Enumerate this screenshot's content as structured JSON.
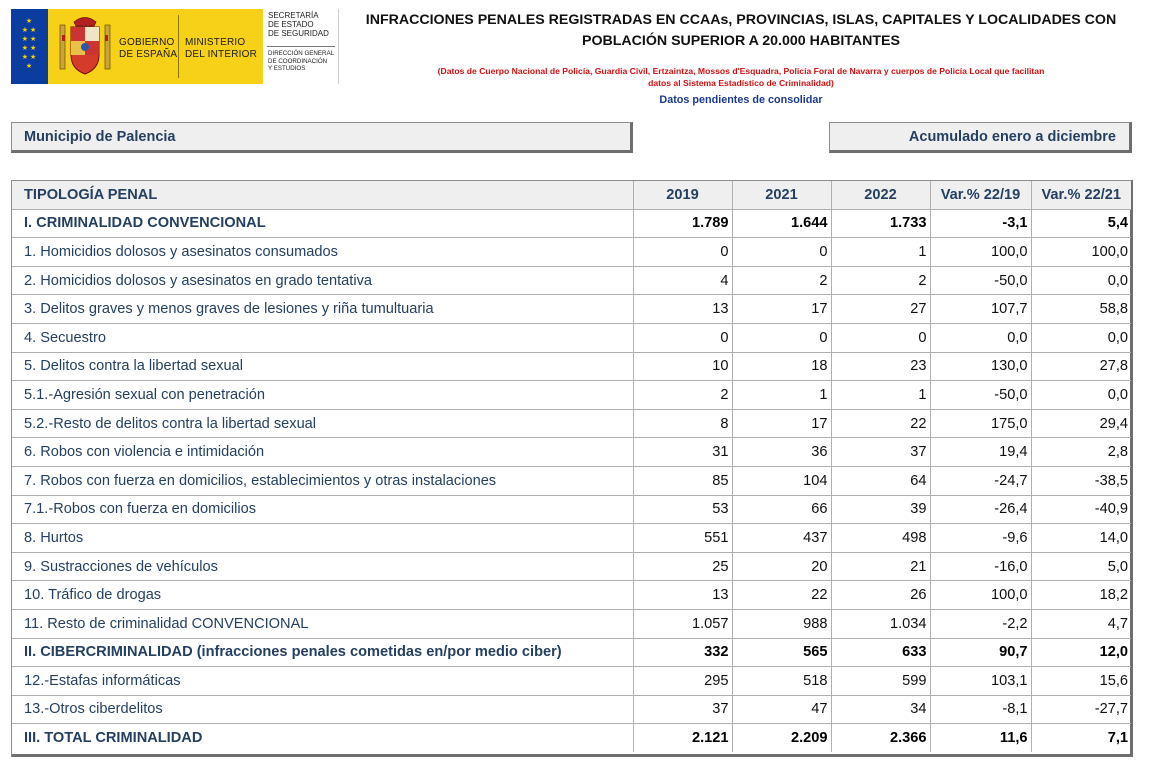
{
  "logo": {
    "gobierno": [
      "GOBIERNO",
      "DE ESPAÑA"
    ],
    "ministerio": [
      "MINISTERIO",
      "DEL INTERIOR"
    ],
    "secretaria": [
      "SECRETARÍA",
      "DE ESTADO",
      "DE SEGURIDAD"
    ],
    "direccion": [
      "DIRECCIÓN GENERAL",
      "DE COORDINACIÓN",
      "Y ESTUDIOS"
    ]
  },
  "header": {
    "title_line1": "INFRACCIONES PENALES REGISTRADAS EN CCAAs, PROVINCIAS, ISLAS, CAPITALES Y LOCALIDADES CON",
    "title_line2": "POBLACIÓN SUPERIOR A 20.000 HABITANTES",
    "source_line1": "(Datos de Cuerpo Nacional de Policía, Guardia Civil, Ertzaintza, Mossos d'Esquadra, Policía Foral de Navarra y cuerpos de Policía Local que facilitan",
    "source_line2": "datos al Sistema Estadístico de Criminalidad)",
    "pending": "Datos pendientes de consolidar"
  },
  "info": {
    "municipio": "Municipio de Palencia",
    "periodo": "Acumulado enero a diciembre"
  },
  "table": {
    "headers": [
      "TIPOLOGÍA PENAL",
      "2019",
      "2021",
      "2022",
      "Var.% 22/19",
      "Var.% 22/21"
    ],
    "rows": [
      {
        "label": "I. CRIMINALIDAD CONVENCIONAL",
        "v2019": "1.789",
        "v2021": "1.644",
        "v2022": "1.733",
        "var1": "-3,1",
        "var2": "5,4",
        "bold": true
      },
      {
        "label": "1. Homicidios dolosos y asesinatos consumados",
        "v2019": "0",
        "v2021": "0",
        "v2022": "1",
        "var1": "100,0",
        "var2": "100,0"
      },
      {
        "label": "2. Homicidios dolosos y asesinatos en grado tentativa",
        "v2019": "4",
        "v2021": "2",
        "v2022": "2",
        "var1": "-50,0",
        "var2": "0,0"
      },
      {
        "label": "3. Delitos graves y menos graves de lesiones y riña tumultuaria",
        "v2019": "13",
        "v2021": "17",
        "v2022": "27",
        "var1": "107,7",
        "var2": "58,8"
      },
      {
        "label": "4. Secuestro",
        "v2019": "0",
        "v2021": "0",
        "v2022": "0",
        "var1": "0,0",
        "var2": "0,0"
      },
      {
        "label": "5. Delitos contra la libertad sexual",
        "v2019": "10",
        "v2021": "18",
        "v2022": "23",
        "var1": "130,0",
        "var2": "27,8"
      },
      {
        "label": "5.1.-Agresión sexual con penetración",
        "v2019": "2",
        "v2021": "1",
        "v2022": "1",
        "var1": "-50,0",
        "var2": "0,0"
      },
      {
        "label": "5.2.-Resto de delitos contra la libertad sexual",
        "v2019": "8",
        "v2021": "17",
        "v2022": "22",
        "var1": "175,0",
        "var2": "29,4"
      },
      {
        "label": "6. Robos con violencia e intimidación",
        "v2019": "31",
        "v2021": "36",
        "v2022": "37",
        "var1": "19,4",
        "var2": "2,8"
      },
      {
        "label": "7. Robos con fuerza en domicilios, establecimientos y otras instalaciones",
        "v2019": "85",
        "v2021": "104",
        "v2022": "64",
        "var1": "-24,7",
        "var2": "-38,5"
      },
      {
        "label": "7.1.-Robos con fuerza en domicilios",
        "v2019": "53",
        "v2021": "66",
        "v2022": "39",
        "var1": "-26,4",
        "var2": "-40,9"
      },
      {
        "label": "8. Hurtos",
        "v2019": "551",
        "v2021": "437",
        "v2022": "498",
        "var1": "-9,6",
        "var2": "14,0"
      },
      {
        "label": "9. Sustracciones de vehículos",
        "v2019": "25",
        "v2021": "20",
        "v2022": "21",
        "var1": "-16,0",
        "var2": "5,0"
      },
      {
        "label": "10. Tráfico de drogas",
        "v2019": "13",
        "v2021": "22",
        "v2022": "26",
        "var1": "100,0",
        "var2": "18,2"
      },
      {
        "label": "11. Resto de criminalidad CONVENCIONAL",
        "v2019": "1.057",
        "v2021": "988",
        "v2022": "1.034",
        "var1": "-2,2",
        "var2": "4,7"
      },
      {
        "label": "II. CIBERCRIMINALIDAD (infracciones penales cometidas en/por medio ciber)",
        "v2019": "332",
        "v2021": "565",
        "v2022": "633",
        "var1": "90,7",
        "var2": "12,0",
        "bold": true
      },
      {
        "label": "12.-Estafas informáticas",
        "v2019": "295",
        "v2021": "518",
        "v2022": "599",
        "var1": "103,1",
        "var2": "15,6"
      },
      {
        "label": "13.-Otros ciberdelitos",
        "v2019": "37",
        "v2021": "47",
        "v2022": "34",
        "var1": "-8,1",
        "var2": "-27,7"
      },
      {
        "label": "III. TOTAL CRIMINALIDAD",
        "v2019": "2.121",
        "v2021": "2.209",
        "v2022": "2.366",
        "var1": "11,6",
        "var2": "7,1",
        "bold": true
      }
    ]
  },
  "colors": {
    "label_blue": "#243f60",
    "red_note": "#d11010",
    "pending_blue": "#1a3a8e",
    "flag_blue": "#0b3da0",
    "logo_yellow": "#f7d117"
  }
}
